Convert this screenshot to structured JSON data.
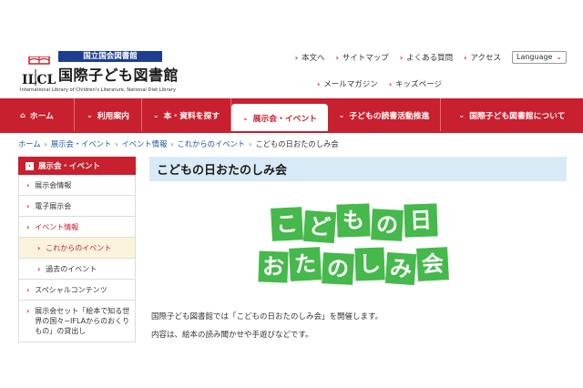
{
  "header": {
    "logo_badge": "国立国会図書館",
    "logo_title": "国際子ども図書館",
    "logo_english": "International Library of Children's Literature, National Diet Library",
    "util_links": [
      "本文へ",
      "サイトマップ",
      "よくある質問",
      "アクセス"
    ],
    "util_links2": [
      "メールマガジン",
      "キッズページ"
    ],
    "language_label": "Language"
  },
  "nav": {
    "items": [
      {
        "label": "ホーム"
      },
      {
        "label": "利用案内"
      },
      {
        "label": "本・資料を探す"
      },
      {
        "label": "展示会・イベント"
      },
      {
        "label": "子どもの読書活動推進"
      },
      {
        "label": "国際子ども図書館について"
      }
    ]
  },
  "breadcrumb": {
    "items": [
      "ホーム",
      "展示会・イベント",
      "イベント情報",
      "これからのイベント"
    ],
    "current": "こどもの日おたのしみ会"
  },
  "sidebar": {
    "heading": "展示会・イベント",
    "items": [
      {
        "label": "展示会情報"
      },
      {
        "label": "電子展示会"
      },
      {
        "label": "イベント情報"
      },
      {
        "label": "これからのイベント"
      },
      {
        "label": "過去のイベント"
      },
      {
        "label": "スペシャルコンテンツ"
      },
      {
        "label": "展示会セット「絵本で知る世界の国々−IFLAからのおくりもの」の貸出し"
      }
    ]
  },
  "main": {
    "title": "こどもの日おたのしみ会",
    "banner_chars_row1": [
      "こ",
      "ど",
      "も",
      "の",
      "日"
    ],
    "banner_chars_row2": [
      "お",
      "た",
      "の",
      "し",
      "み",
      "会"
    ],
    "paragraph1": "国際子ども図書館では「こどもの日おたのしみ会」を開催します。",
    "paragraph2": "内容は、絵本の読み聞かせや手遊びなどです。"
  },
  "colors": {
    "brand_red": "#c8202e",
    "navy": "#1d3d8f",
    "banner_green": "#45b94b",
    "title_bar": "#d9eaf7"
  }
}
